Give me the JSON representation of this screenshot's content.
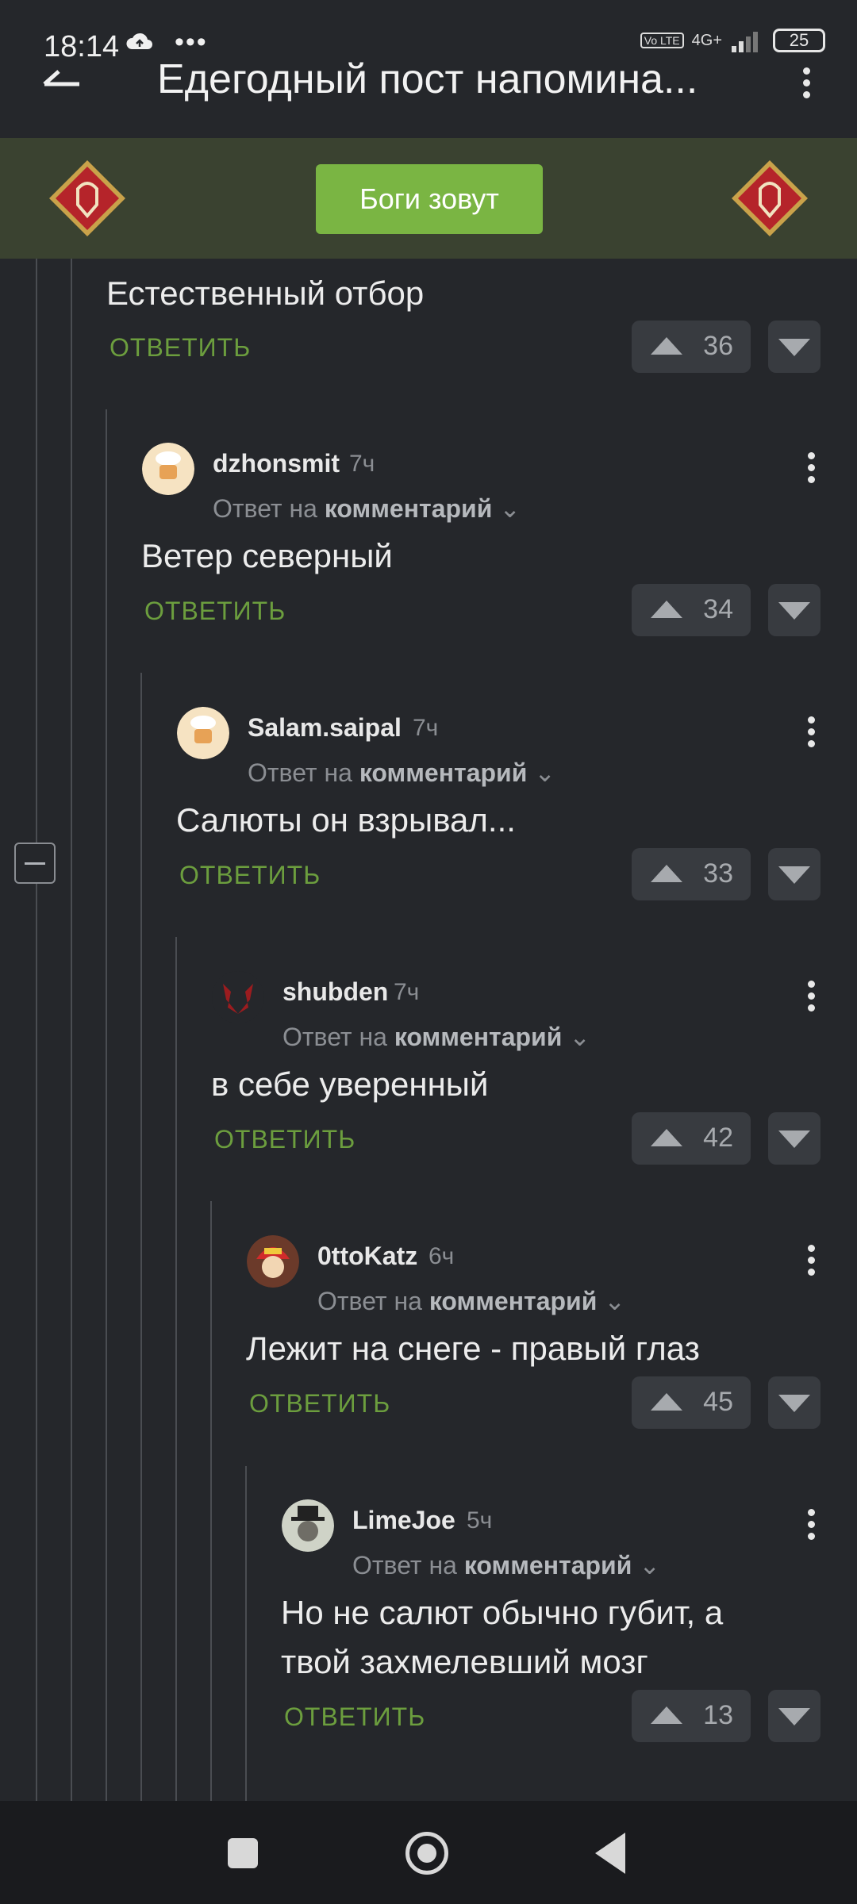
{
  "status": {
    "time": "18:14",
    "dots": "•••",
    "volte": "Vo LTE",
    "network": "4G+",
    "battery": "25"
  },
  "header": {
    "title": "Едегодный пост напомина..."
  },
  "banner": {
    "button_label": "Боги зовут"
  },
  "comments": [
    {
      "text": "Естественный отбор",
      "reply_label": "ОТВЕТИТЬ",
      "votes": "36"
    },
    {
      "user": "dzhonsmit",
      "time": "7ч",
      "reply_prefix": "Ответ на",
      "reply_target": "комментарий",
      "text": "Ветер северный",
      "reply_label": "ОТВЕТИТЬ",
      "votes": "34"
    },
    {
      "user": "Salam.saipal",
      "time": "7ч",
      "reply_prefix": "Ответ на",
      "reply_target": "комментарий",
      "text": "Салюты он взрывал...",
      "reply_label": "ОТВЕТИТЬ",
      "votes": "33"
    },
    {
      "user": "shubden",
      "time": "7ч",
      "reply_prefix": "Ответ на",
      "reply_target": "комментарий",
      "text": "в себе уверенный",
      "reply_label": "ОТВЕТИТЬ",
      "votes": "42"
    },
    {
      "user": "0ttoKatz",
      "time": "6ч",
      "reply_prefix": "Ответ на",
      "reply_target": "комментарий",
      "text": "Лежит на снеге - правый глаз",
      "reply_label": "ОТВЕТИТЬ",
      "votes": "45"
    },
    {
      "user": "LimeJoe",
      "time": "5ч",
      "reply_prefix": "Ответ на",
      "reply_target": "комментарий",
      "text_line1": "Но не салют обычно губит, а",
      "text_line2": "твой захмелевший мозг",
      "reply_label": "ОТВЕТИТЬ",
      "votes": "13"
    }
  ],
  "colors": {
    "background": "#25272b",
    "accent_green": "#7ab543",
    "reply_green": "#6c9e3e",
    "banner_bg": "#3a4230"
  }
}
